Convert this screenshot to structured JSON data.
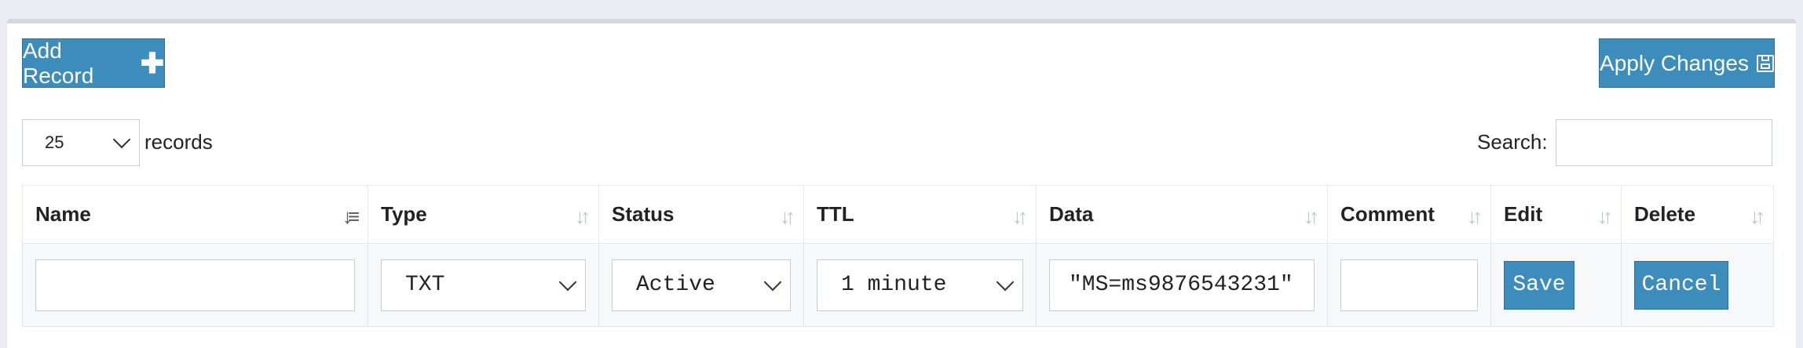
{
  "toolbar": {
    "add_record_label": "Add Record",
    "apply_changes_label": "Apply Changes"
  },
  "length_menu": {
    "selected": "25",
    "suffix": "records"
  },
  "search": {
    "label": "Search:",
    "value": ""
  },
  "table": {
    "columns": [
      "Name",
      "Type",
      "Status",
      "TTL",
      "Data",
      "Comment",
      "Edit",
      "Delete"
    ],
    "sorted_column": "Name",
    "edit_row": {
      "name": "",
      "type": "TXT",
      "status": "Active",
      "ttl": "1 minute",
      "data": "\"MS=ms9876543231\"",
      "comment": "",
      "save_label": "Save",
      "cancel_label": "Cancel"
    }
  },
  "colors": {
    "primary_button": "#3c8dbc",
    "page_background": "#e9ecf1"
  }
}
